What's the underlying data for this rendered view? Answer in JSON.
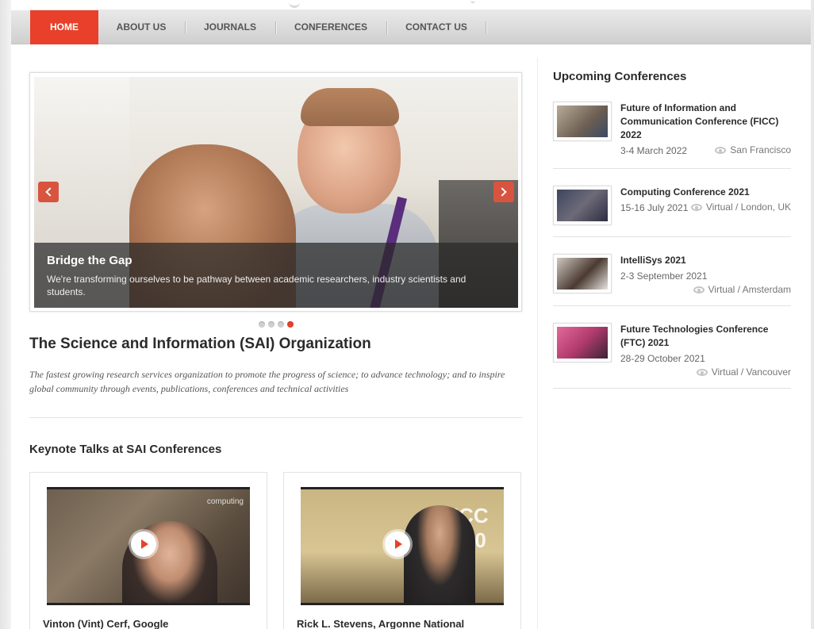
{
  "nav": {
    "items": [
      {
        "label": "HOME",
        "active": true
      },
      {
        "label": "ABOUT US",
        "active": false
      },
      {
        "label": "JOURNALS",
        "active": false
      },
      {
        "label": "CONFERENCES",
        "active": false
      },
      {
        "label": "CONTACT US",
        "active": false
      }
    ]
  },
  "slider": {
    "title": "Bridge the Gap",
    "text": "We're transforming ourselves to be pathway between academic researchers, industry scientists and students.",
    "prev_icon": "chevron-left-icon",
    "next_icon": "chevron-right-icon",
    "slide_count": 4,
    "active_slide": 4
  },
  "org": {
    "title": "The Science and Information (SAI) Organization",
    "tagline": "The fastest growing research services organization to promote the progress of science; to advance technology; and to inspire global community through events, publications, conferences and technical activities"
  },
  "keynotes": {
    "title": "Keynote Talks at SAI Conferences",
    "videos": [
      {
        "name": "Vinton (Vint) Cerf, Google",
        "overlay": "computing"
      },
      {
        "name": "Rick L. Stevens, Argonne National",
        "overlay": "FICC 2020"
      }
    ]
  },
  "sidebar": {
    "title": "Upcoming Conferences",
    "conferences": [
      {
        "name": "Future of Information and Communication Conference (FICC) 2022",
        "date": "3-4 March 2022",
        "location": "San Francisco"
      },
      {
        "name": "Computing Conference 2021",
        "date": "15-16 July 2021",
        "location": "Virtual / London, UK"
      },
      {
        "name": "IntelliSys 2021",
        "date": "2-3 September 2021",
        "location": "Virtual / Amsterdam"
      },
      {
        "name": "Future Technologies Conference (FTC) 2021",
        "date": "28-29 October 2021",
        "location": "Virtual / Vancouver"
      }
    ]
  },
  "colors": {
    "accent": "#e8402a",
    "nav_bg": "#d8d8d8",
    "text": "#2b2b2b"
  }
}
